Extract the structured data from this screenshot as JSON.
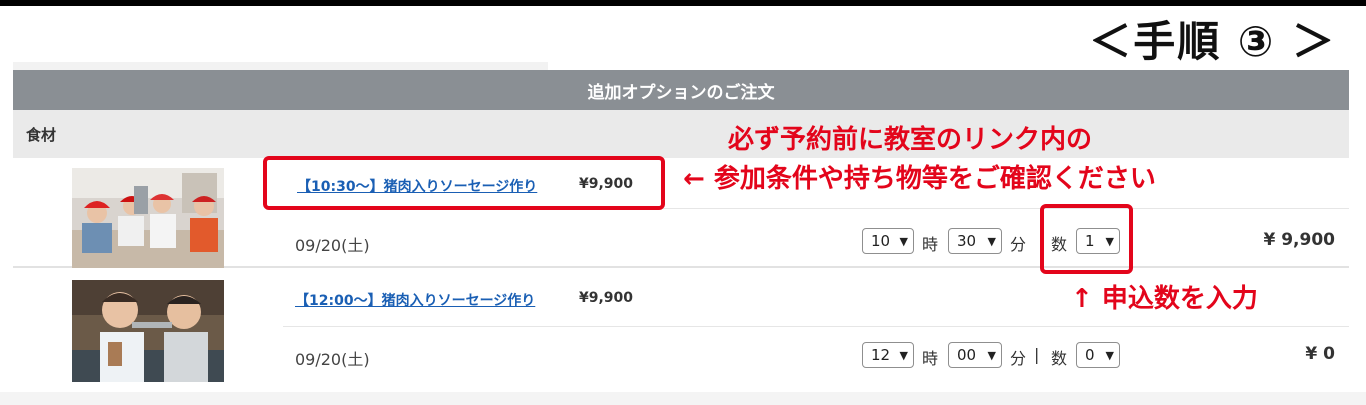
{
  "step_title": "＜手順 ③ ＞",
  "section_title": "追加オプションのご注文",
  "category": "食材",
  "items": [
    {
      "name": "【10:30〜】猪肉入りソーセージ作り",
      "price": "¥9,900",
      "date": "09/20(土)",
      "hour": "10",
      "minute": "30",
      "qty": "1",
      "total": "¥ 9,900"
    },
    {
      "name": "【12:00〜】猪肉入りソーセージ作り",
      "price": "¥9,900",
      "date": "09/20(土)",
      "hour": "12",
      "minute": "00",
      "qty": "0",
      "total": "¥ 0"
    }
  ],
  "labels": {
    "hour": "時",
    "minute": "分",
    "qty": "数",
    "separator": "|"
  },
  "annotations": {
    "line1": "必ず予約前に教室のリンク内の",
    "line2": "← 参加条件や持ち物等をご確認ください",
    "qty_note": "↑ 申込数を入力"
  },
  "colors": {
    "accent_red": "#e3051b",
    "link_blue": "#1a5fb4",
    "header_gray": "#8a8f94"
  }
}
